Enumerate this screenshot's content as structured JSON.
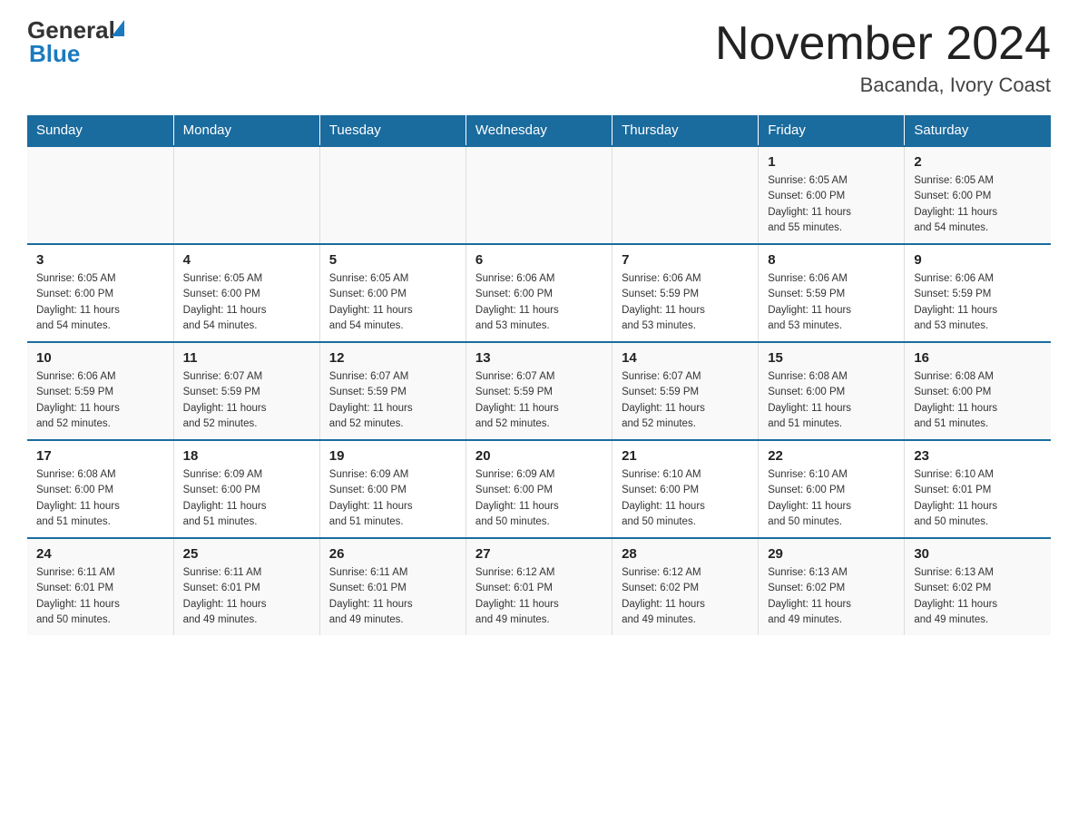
{
  "header": {
    "logo_general": "General",
    "logo_blue": "Blue",
    "title": "November 2024",
    "subtitle": "Bacanda, Ivory Coast"
  },
  "days_of_week": [
    "Sunday",
    "Monday",
    "Tuesday",
    "Wednesday",
    "Thursday",
    "Friday",
    "Saturday"
  ],
  "weeks": [
    [
      {
        "day": "",
        "info": ""
      },
      {
        "day": "",
        "info": ""
      },
      {
        "day": "",
        "info": ""
      },
      {
        "day": "",
        "info": ""
      },
      {
        "day": "",
        "info": ""
      },
      {
        "day": "1",
        "info": "Sunrise: 6:05 AM\nSunset: 6:00 PM\nDaylight: 11 hours\nand 55 minutes."
      },
      {
        "day": "2",
        "info": "Sunrise: 6:05 AM\nSunset: 6:00 PM\nDaylight: 11 hours\nand 54 minutes."
      }
    ],
    [
      {
        "day": "3",
        "info": "Sunrise: 6:05 AM\nSunset: 6:00 PM\nDaylight: 11 hours\nand 54 minutes."
      },
      {
        "day": "4",
        "info": "Sunrise: 6:05 AM\nSunset: 6:00 PM\nDaylight: 11 hours\nand 54 minutes."
      },
      {
        "day": "5",
        "info": "Sunrise: 6:05 AM\nSunset: 6:00 PM\nDaylight: 11 hours\nand 54 minutes."
      },
      {
        "day": "6",
        "info": "Sunrise: 6:06 AM\nSunset: 6:00 PM\nDaylight: 11 hours\nand 53 minutes."
      },
      {
        "day": "7",
        "info": "Sunrise: 6:06 AM\nSunset: 5:59 PM\nDaylight: 11 hours\nand 53 minutes."
      },
      {
        "day": "8",
        "info": "Sunrise: 6:06 AM\nSunset: 5:59 PM\nDaylight: 11 hours\nand 53 minutes."
      },
      {
        "day": "9",
        "info": "Sunrise: 6:06 AM\nSunset: 5:59 PM\nDaylight: 11 hours\nand 53 minutes."
      }
    ],
    [
      {
        "day": "10",
        "info": "Sunrise: 6:06 AM\nSunset: 5:59 PM\nDaylight: 11 hours\nand 52 minutes."
      },
      {
        "day": "11",
        "info": "Sunrise: 6:07 AM\nSunset: 5:59 PM\nDaylight: 11 hours\nand 52 minutes."
      },
      {
        "day": "12",
        "info": "Sunrise: 6:07 AM\nSunset: 5:59 PM\nDaylight: 11 hours\nand 52 minutes."
      },
      {
        "day": "13",
        "info": "Sunrise: 6:07 AM\nSunset: 5:59 PM\nDaylight: 11 hours\nand 52 minutes."
      },
      {
        "day": "14",
        "info": "Sunrise: 6:07 AM\nSunset: 5:59 PM\nDaylight: 11 hours\nand 52 minutes."
      },
      {
        "day": "15",
        "info": "Sunrise: 6:08 AM\nSunset: 6:00 PM\nDaylight: 11 hours\nand 51 minutes."
      },
      {
        "day": "16",
        "info": "Sunrise: 6:08 AM\nSunset: 6:00 PM\nDaylight: 11 hours\nand 51 minutes."
      }
    ],
    [
      {
        "day": "17",
        "info": "Sunrise: 6:08 AM\nSunset: 6:00 PM\nDaylight: 11 hours\nand 51 minutes."
      },
      {
        "day": "18",
        "info": "Sunrise: 6:09 AM\nSunset: 6:00 PM\nDaylight: 11 hours\nand 51 minutes."
      },
      {
        "day": "19",
        "info": "Sunrise: 6:09 AM\nSunset: 6:00 PM\nDaylight: 11 hours\nand 51 minutes."
      },
      {
        "day": "20",
        "info": "Sunrise: 6:09 AM\nSunset: 6:00 PM\nDaylight: 11 hours\nand 50 minutes."
      },
      {
        "day": "21",
        "info": "Sunrise: 6:10 AM\nSunset: 6:00 PM\nDaylight: 11 hours\nand 50 minutes."
      },
      {
        "day": "22",
        "info": "Sunrise: 6:10 AM\nSunset: 6:00 PM\nDaylight: 11 hours\nand 50 minutes."
      },
      {
        "day": "23",
        "info": "Sunrise: 6:10 AM\nSunset: 6:01 PM\nDaylight: 11 hours\nand 50 minutes."
      }
    ],
    [
      {
        "day": "24",
        "info": "Sunrise: 6:11 AM\nSunset: 6:01 PM\nDaylight: 11 hours\nand 50 minutes."
      },
      {
        "day": "25",
        "info": "Sunrise: 6:11 AM\nSunset: 6:01 PM\nDaylight: 11 hours\nand 49 minutes."
      },
      {
        "day": "26",
        "info": "Sunrise: 6:11 AM\nSunset: 6:01 PM\nDaylight: 11 hours\nand 49 minutes."
      },
      {
        "day": "27",
        "info": "Sunrise: 6:12 AM\nSunset: 6:01 PM\nDaylight: 11 hours\nand 49 minutes."
      },
      {
        "day": "28",
        "info": "Sunrise: 6:12 AM\nSunset: 6:02 PM\nDaylight: 11 hours\nand 49 minutes."
      },
      {
        "day": "29",
        "info": "Sunrise: 6:13 AM\nSunset: 6:02 PM\nDaylight: 11 hours\nand 49 minutes."
      },
      {
        "day": "30",
        "info": "Sunrise: 6:13 AM\nSunset: 6:02 PM\nDaylight: 11 hours\nand 49 minutes."
      }
    ]
  ]
}
